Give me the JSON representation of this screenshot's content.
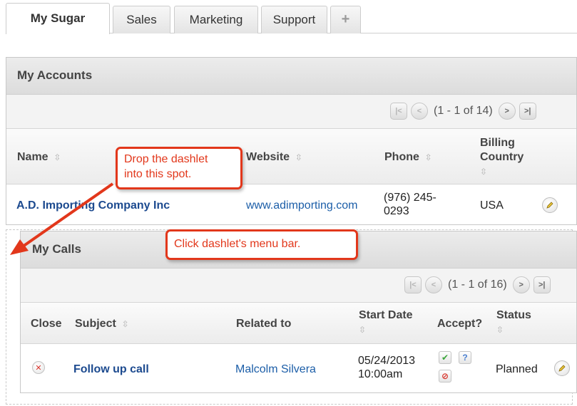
{
  "tabs": [
    {
      "label": "My Sugar"
    },
    {
      "label": "Sales"
    },
    {
      "label": "Marketing"
    },
    {
      "label": "Support"
    },
    {
      "label": "+"
    }
  ],
  "accounts": {
    "title": "My Accounts",
    "pager": "(1 - 1 of 14)",
    "columns": {
      "name": "Name",
      "website": "Website",
      "phone": "Phone",
      "billing_line1": "Billing",
      "billing_line2": "Country"
    },
    "row": {
      "name": "A.D. Importing Company Inc",
      "website": "www.adimporting.com",
      "phone_line1": "(976) 245-",
      "phone_line2": "0293",
      "country": "USA"
    }
  },
  "calls": {
    "title": "My Calls",
    "pager": "(1 - 1 of 16)",
    "columns": {
      "close": "Close",
      "subject": "Subject",
      "related": "Related to",
      "start_line1": "Start Date",
      "accept": "Accept?",
      "status": "Status"
    },
    "row": {
      "subject": "Follow up call",
      "related": "Malcolm Silvera",
      "date": "05/24/2013",
      "time": "10:00am",
      "status": "Planned"
    }
  },
  "callouts": {
    "drop_line1": "Drop the dashlet",
    "drop_line2": "into this spot.",
    "click": "Click dashlet's menu bar."
  },
  "colors": {
    "callout": "#e2371b",
    "link": "#1c5ea8",
    "accept": "#3aa53a",
    "decline": "#d9342b"
  },
  "icons": [
    "first-page-icon",
    "prev-page-icon",
    "next-page-icon",
    "last-page-icon",
    "sort-icon",
    "edit-pencil-icon",
    "close-x-icon",
    "accept-check-icon",
    "tentative-question-icon",
    "decline-icon",
    "arrow-icon"
  ]
}
